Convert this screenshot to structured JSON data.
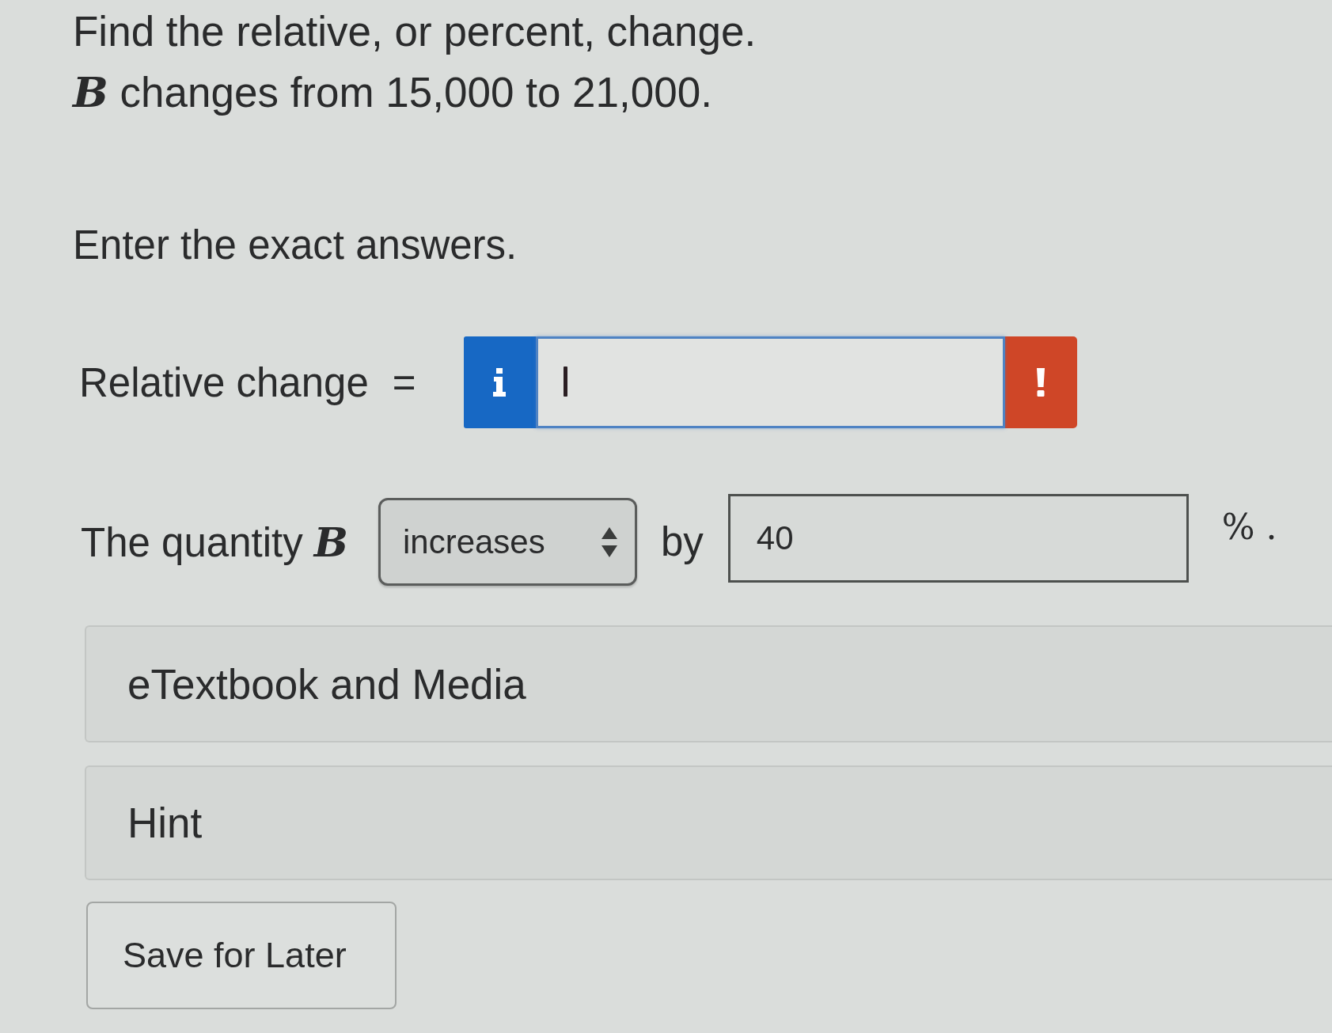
{
  "question": {
    "title": "Find the relative, or percent, change.",
    "statement": "*B* changes from 15,000 to 21,000.",
    "instruction": "Enter the exact answers."
  },
  "answers": [
    {
      "kind": "input_group",
      "label": "Relative change",
      "operator": "=",
      "focused": true,
      "error": true
    },
    {
      "kind": "sentence",
      "label": "The quantity *B*",
      "select": {
        "value": "increases"
      },
      "connector": "by",
      "input": {
        "value": "40"
      },
      "suffix": "% ."
    }
  ],
  "panels": [
    {
      "label": "eTextbook and Media"
    },
    {
      "label": "Hint"
    }
  ],
  "buttons": [
    {
      "label": "Save for Later"
    }
  ]
}
